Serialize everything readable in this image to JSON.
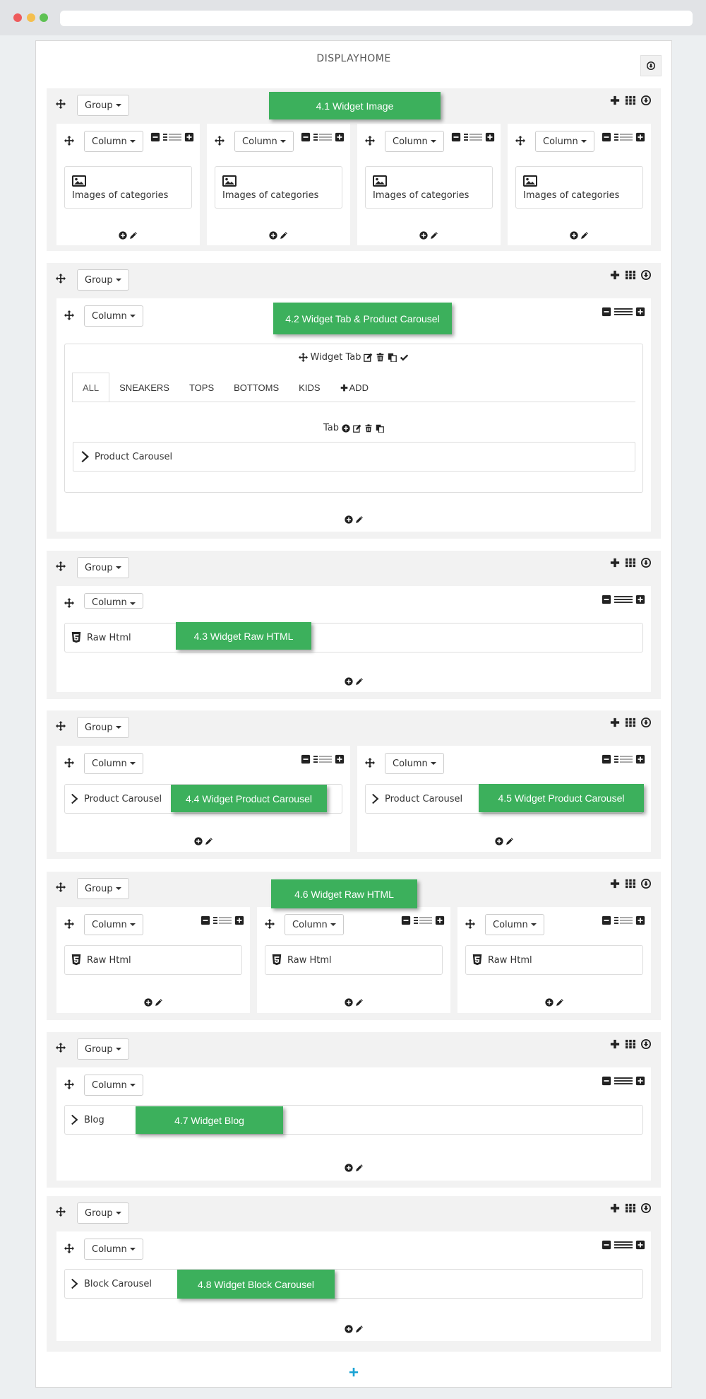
{
  "page": {
    "title": "DISPLAYHOME"
  },
  "labels": {
    "group": "Group",
    "column": "Column",
    "images_of_categories": "Images of categories",
    "product_carousel": "Product Carousel",
    "raw_html": "Raw Html",
    "blog": "Blog",
    "block_carousel": "Block Carousel",
    "widget_tab": "Widget Tab",
    "tab": "Tab"
  },
  "tabs": [
    "ALL",
    "SNEAKERS",
    "TOPS",
    "BOTTOMS",
    "KIDS",
    "ADD"
  ],
  "annotations": {
    "a1": "4.1 Widget Image",
    "a2": "4.2 Widget Tab & Product Carousel",
    "a3": "4.3 Widget Raw HTML",
    "a4": "4.4 Widget  Product Carousel",
    "a5": "4.5 Widget  Product Carousel",
    "a6": "4.6 Widget Raw HTML",
    "a7": "4.7 Widget Blog",
    "a8": "4.8 Widget Block Carousel"
  },
  "colors": {
    "annotation": "#3cb05c",
    "add_group": "#1aa3d4"
  },
  "icons": [
    "move-icon",
    "caret-down-icon",
    "plus-icon",
    "grid-icon",
    "arrow-circle-down-icon",
    "minus-square-icon",
    "plus-square-icon",
    "column-size-icon",
    "image-icon",
    "plus-circle-icon",
    "pencil-icon",
    "edit-icon",
    "trash-icon",
    "copy-icon",
    "check-icon",
    "html5-icon",
    "chevron-right-icon"
  ]
}
